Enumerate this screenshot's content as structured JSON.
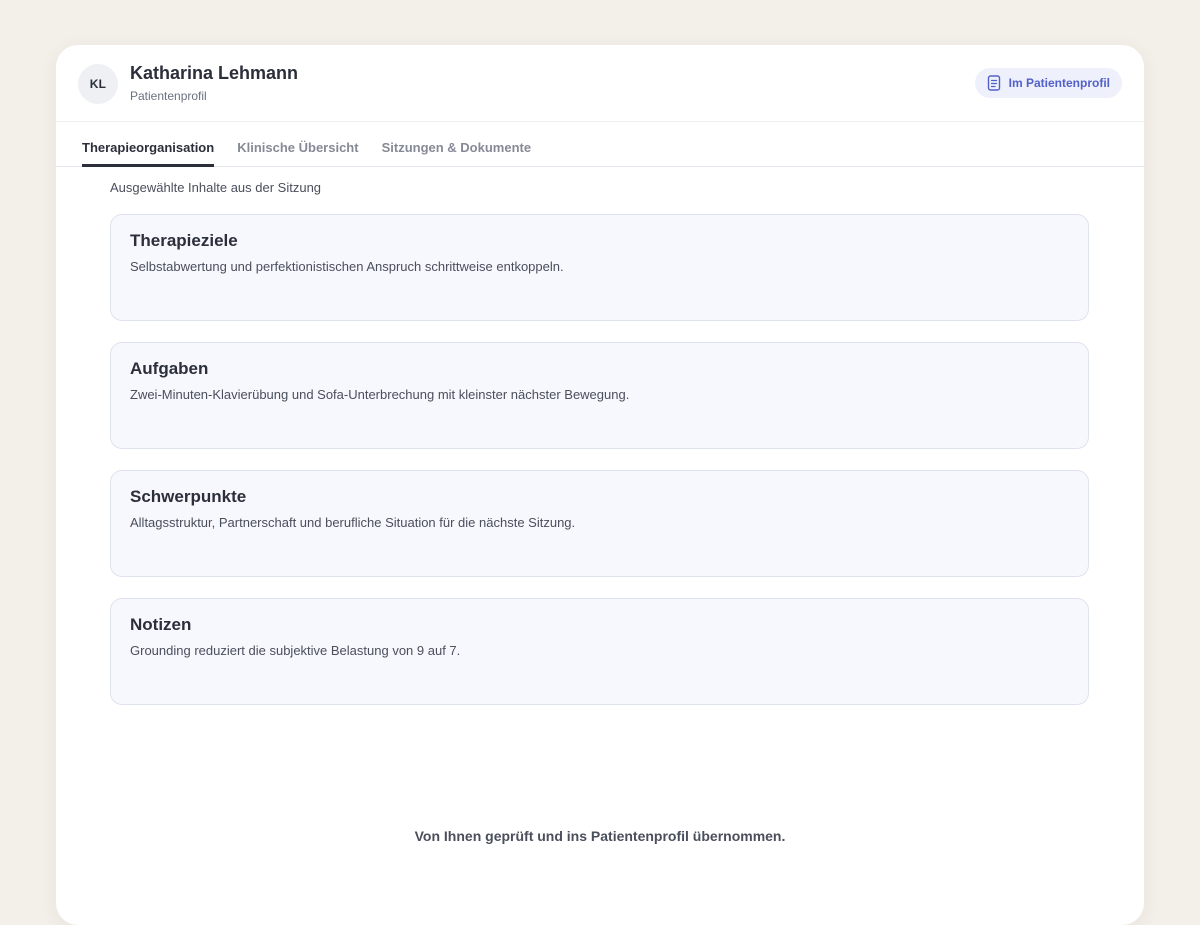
{
  "patient": {
    "initials": "KL",
    "name": "Katharina Lehmann",
    "subtitle": "Patientenprofil"
  },
  "badge": {
    "label": "Im Patientenprofil",
    "icon": "document-icon"
  },
  "tabs": [
    {
      "label": "Therapieorganisation",
      "active": true
    },
    {
      "label": "Klinische Übersicht",
      "active": false
    },
    {
      "label": "Sitzungen & Dokumente",
      "active": false
    }
  ],
  "intro": "Ausgewählte Inhalte aus der Sitzung",
  "sections": [
    {
      "title": "Therapieziele",
      "text": "Selbstabwertung und perfektionistischen Anspruch schrittweise entkoppeln."
    },
    {
      "title": "Aufgaben",
      "text": "Zwei-Minuten-Klavierübung und Sofa-Unterbrechung mit kleinster nächster Bewegung."
    },
    {
      "title": "Schwerpunkte",
      "text": "Alltagsstruktur, Partnerschaft und berufliche Situation für die nächste Sitzung."
    },
    {
      "title": "Notizen",
      "text": "Grounding reduziert die subjektive Belastung von 9 auf 7."
    }
  ],
  "footer_note": "Von Ihnen geprüft und ins Patientenprofil übernommen.",
  "colors": {
    "accent": "#5260c9",
    "background": "#f3efe9",
    "section_bg": "#f7f8fd",
    "text": "#2b2f3a"
  }
}
